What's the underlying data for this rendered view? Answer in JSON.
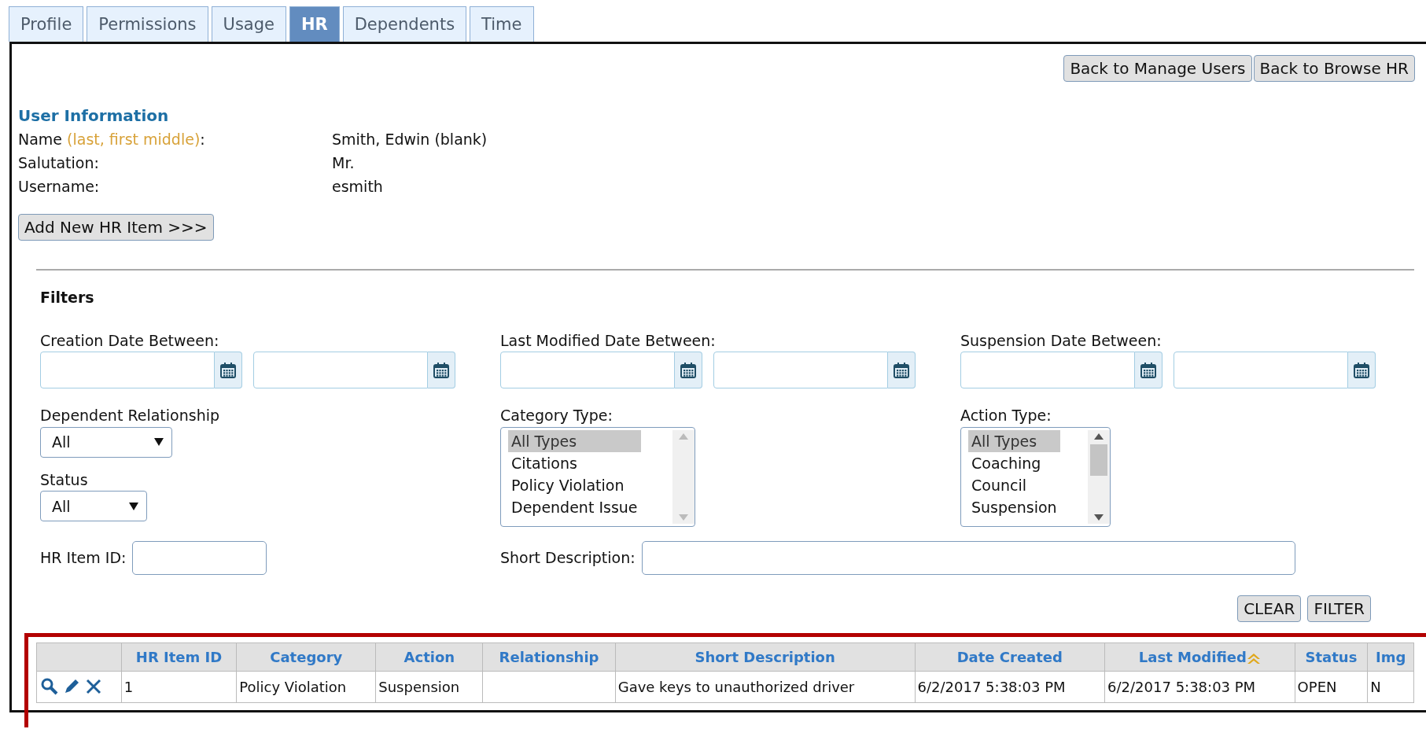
{
  "tabs": [
    {
      "label": "Profile",
      "selected": false
    },
    {
      "label": "Permissions",
      "selected": false
    },
    {
      "label": "Usage",
      "selected": false
    },
    {
      "label": "HR",
      "selected": true
    },
    {
      "label": "Dependents",
      "selected": false
    },
    {
      "label": "Time",
      "selected": false
    }
  ],
  "header_buttons": [
    "Back to Manage Users",
    "Back to Browse HR"
  ],
  "user_information": {
    "title": "User Information",
    "fields": [
      {
        "label": "Name ",
        "hint": "(last, first middle)",
        "label_end": ":",
        "value": "Smith, Edwin (blank)"
      },
      {
        "label": "Salutation:",
        "value": "Mr."
      },
      {
        "label": "Username:",
        "value": "esmith"
      }
    ]
  },
  "add_button": "Add New HR Item >>>",
  "filters": {
    "title": "Filters",
    "date_ranges": [
      {
        "label": "Creation Date Between:"
      },
      {
        "label": "Last Modified Date Between:"
      },
      {
        "label": "Suspension Date Between:"
      }
    ],
    "selects": [
      {
        "label": "Dependent Relationship",
        "value": "All"
      },
      {
        "label": "Status",
        "value": "All"
      }
    ],
    "listboxes": [
      {
        "label": "Category Type:",
        "scrollbar_enabled": false,
        "options": [
          {
            "text": "All Types",
            "selected": true
          },
          {
            "text": "Citations",
            "selected": false
          },
          {
            "text": "Policy Violation",
            "selected": false
          },
          {
            "text": "Dependent Issue",
            "selected": false
          }
        ]
      },
      {
        "label": "Action Type:",
        "scrollbar_enabled": true,
        "options": [
          {
            "text": "All Types",
            "selected": true
          },
          {
            "text": "Coaching",
            "selected": false
          },
          {
            "text": "Council",
            "selected": false
          },
          {
            "text": "Suspension",
            "selected": false
          }
        ]
      }
    ],
    "hr_item_id": {
      "label": "HR Item ID:"
    },
    "short_description": {
      "label": "Short Description:"
    },
    "buttons": [
      "CLEAR",
      "FILTER"
    ]
  },
  "table": {
    "columns": [
      {
        "label": "HR Item ID",
        "sorted": false
      },
      {
        "label": "Category",
        "sorted": false
      },
      {
        "label": "Action",
        "sorted": false
      },
      {
        "label": "Relationship",
        "sorted": false
      },
      {
        "label": "Short Description",
        "sorted": false
      },
      {
        "label": "Date Created",
        "sorted": false
      },
      {
        "label": "Last Modified",
        "sorted": true
      },
      {
        "label": "Status",
        "sorted": false
      },
      {
        "label": "Img",
        "sorted": false
      }
    ],
    "rows": [
      {
        "cells": [
          "1",
          "Policy Violation",
          "Suspension",
          "",
          "Gave keys to unauthorized driver",
          "6/2/2017 5:38:03 PM",
          "6/2/2017 5:38:03 PM",
          "OPEN",
          "N"
        ]
      }
    ]
  }
}
